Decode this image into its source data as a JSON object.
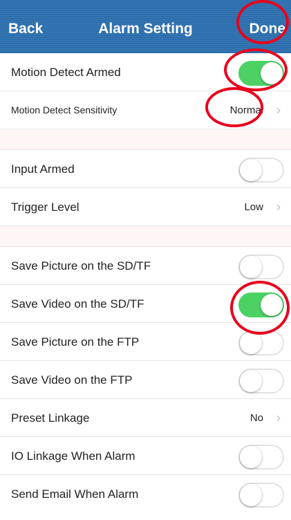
{
  "nav": {
    "back_label": "Back",
    "title": "Alarm Setting",
    "done_label": "Done"
  },
  "sections": [
    {
      "rows": [
        {
          "key": "motion_detect_armed",
          "label": "Motion Detect Armed",
          "type": "toggle",
          "on": true
        },
        {
          "key": "motion_detect_sensitivity",
          "label": "Motion Detect Sensitivity",
          "type": "value",
          "value": "Normal"
        }
      ]
    },
    {
      "rows": [
        {
          "key": "input_armed",
          "label": "Input Armed",
          "type": "toggle",
          "on": false
        },
        {
          "key": "trigger_level",
          "label": "Trigger Level",
          "type": "value",
          "value": "Low"
        }
      ]
    },
    {
      "rows": [
        {
          "key": "save_picture_sd",
          "label": "Save Picture on the SD/TF",
          "type": "toggle",
          "on": false
        },
        {
          "key": "save_video_sd",
          "label": "Save Video on the SD/TF",
          "type": "toggle",
          "on": true
        },
        {
          "key": "save_picture_ftp",
          "label": "Save Picture on the FTP",
          "type": "toggle",
          "on": false
        },
        {
          "key": "save_video_ftp",
          "label": "Save Video on the FTP",
          "type": "toggle",
          "on": false
        },
        {
          "key": "preset_linkage",
          "label": "Preset Linkage",
          "type": "value",
          "value": "No"
        },
        {
          "key": "io_linkage",
          "label": "IO Linkage When Alarm",
          "type": "toggle",
          "on": false
        },
        {
          "key": "send_email",
          "label": "Send Email When Alarm",
          "type": "toggle",
          "on": false
        }
      ]
    }
  ],
  "icons": {
    "disclosure": "chevron-right-icon"
  },
  "colors": {
    "nav_bar": "#2d6fae",
    "toggle_on": "#4cd164",
    "annotation": "#e8001c",
    "section_gap": "#fff6f6"
  }
}
